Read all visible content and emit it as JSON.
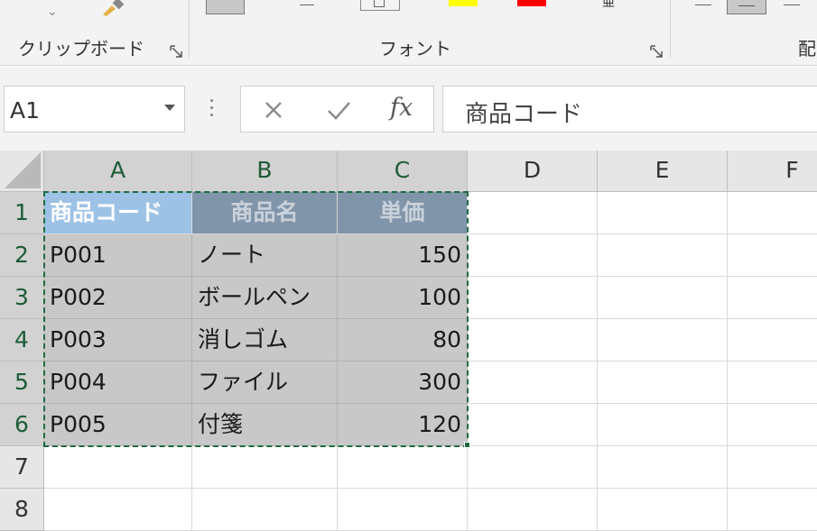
{
  "ribbon": {
    "groups": [
      {
        "label": "クリップボード"
      },
      {
        "label": "フォント"
      },
      {
        "label": "配"
      }
    ],
    "swatches": {
      "highlight": "#ffff00",
      "font_color": "#ff0000"
    }
  },
  "formula_bar": {
    "name_box": "A1",
    "fx_label": "fx",
    "formula": "商品コード"
  },
  "grid": {
    "columns": [
      "A",
      "B",
      "C",
      "D",
      "E",
      "F"
    ],
    "rows": [
      "1",
      "2",
      "3",
      "4",
      "5",
      "6",
      "7",
      "8"
    ],
    "header": [
      "商品コード",
      "商品名",
      "単価"
    ],
    "data": [
      [
        "P001",
        "ノート",
        "150"
      ],
      [
        "P002",
        "ボールペン",
        "100"
      ],
      [
        "P003",
        "消しゴム",
        "80"
      ],
      [
        "P004",
        "ファイル",
        "300"
      ],
      [
        "P005",
        "付箋",
        "120"
      ]
    ]
  },
  "colors": {
    "accent": "#1e6b41",
    "header_fill": "#8094aa",
    "active_header_fill": "#9dc2e6",
    "data_fill": "#c8c8c8"
  }
}
